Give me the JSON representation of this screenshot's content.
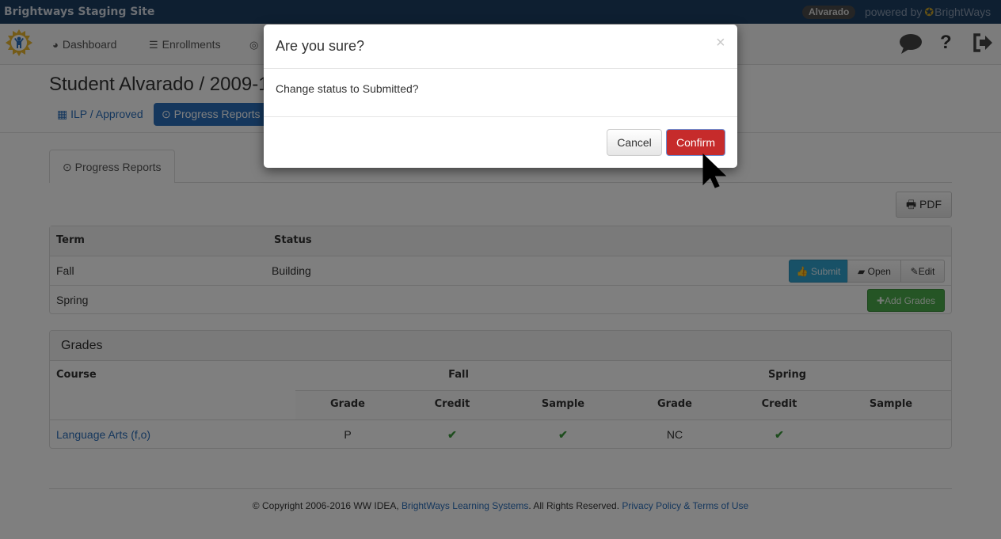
{
  "topbar": {
    "site_title": "Brightways Staging Site",
    "user_badge": "Alvarado",
    "powered_by": "powered by",
    "powered_brand": "BrightWays"
  },
  "navbar": {
    "items": [
      {
        "label": "Dashboard",
        "icon": "dashboard-icon"
      },
      {
        "label": "Enrollments",
        "icon": "list-icon"
      },
      {
        "label": "",
        "icon": "compass-icon"
      }
    ],
    "right_icons": [
      "comment-icon",
      "help-icon",
      "logout-icon"
    ]
  },
  "page": {
    "title": "Student Alvarado / 2009-1",
    "subnav": [
      {
        "label": "ILP / Approved",
        "icon": "table-icon",
        "active": false
      },
      {
        "label": "Progress Reports",
        "icon": "check-circle-icon",
        "active": true
      }
    ]
  },
  "tab": {
    "label": "Progress Reports"
  },
  "pdf_button": "PDF",
  "reports_table": {
    "headers": [
      "Term",
      "Status"
    ],
    "rows": [
      {
        "term": "Fall",
        "status": "Building",
        "actions": [
          "Submit",
          "Open",
          "Edit"
        ]
      },
      {
        "term": "Spring",
        "status": "",
        "actions": [
          "Add Grades"
        ]
      }
    ]
  },
  "grades": {
    "title": "Grades",
    "course_header": "Course",
    "term_headers": [
      "Fall",
      "Spring"
    ],
    "sub_headers": [
      "Grade",
      "Credit",
      "Sample",
      "Grade",
      "Credit",
      "Sample"
    ],
    "rows": [
      {
        "course": "Language Arts",
        "course_suffix": "(f,o)",
        "fall_grade": "P",
        "fall_credit": "✔",
        "fall_sample": "✔",
        "spring_grade": "NC",
        "spring_credit": "✔",
        "spring_sample": ""
      }
    ]
  },
  "footer": {
    "copyright": "© Copyright 2006-2016 WW IDEA, ",
    "company_link": "BrightWays Learning Systems",
    "rights": ". All Rights Reserved. ",
    "policy_link": "Privacy Policy & Terms of Use"
  },
  "modal": {
    "title": "Are you sure?",
    "close": "×",
    "body": "Change status to Submitted?",
    "cancel_label": "Cancel",
    "confirm_label": "Confirm"
  },
  "colors": {
    "topbar": "#1c3e63",
    "primary": "#2a6ebb",
    "info": "#31a2cf",
    "success": "#4aaa4a",
    "danger": "#c62b2b"
  }
}
